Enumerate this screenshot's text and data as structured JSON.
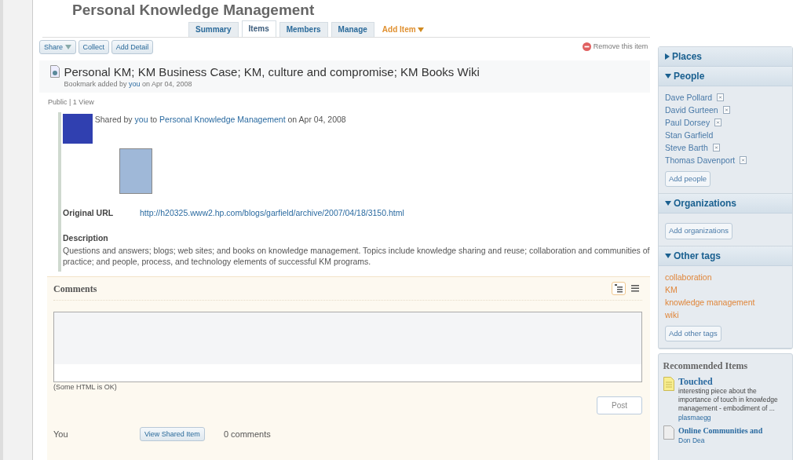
{
  "page_title": "Personal Knowledge Management",
  "tabs": [
    {
      "label": "Summary",
      "selected": false
    },
    {
      "label": "Items",
      "selected": true
    },
    {
      "label": "Members",
      "selected": false
    },
    {
      "label": "Manage",
      "selected": false
    }
  ],
  "add_item": {
    "label": "Add Item"
  },
  "toolbar": [
    {
      "label": "Share",
      "dropdown": true
    },
    {
      "label": "Collect",
      "dropdown": false
    },
    {
      "label": "Add Detail",
      "dropdown": false
    }
  ],
  "remove_link": "Remove this item",
  "item": {
    "title": "Personal KM; KM Business Case; KM, culture and compromise; KM Books Wiki",
    "added_prefix": "Bookmark added by",
    "added_by": "you",
    "added_date": "on Apr 04, 2008",
    "visibility": "Public | 1 View",
    "shared_prefix": "Shared by",
    "shared_by": "you",
    "shared_to_word": "to",
    "shared_group": "Personal Knowledge Management",
    "shared_date": "on Apr 04, 2008",
    "url_label": "Original URL",
    "url": "http://h20325.www2.hp.com/blogs/garfield/archive/2007/04/18/3150.html",
    "description_label": "Description",
    "description": "Questions and answers; blogs; web sites; and books on knowledge management. Topics include knowledge sharing and reuse; collaboration and communities of practice; and people, process, and technology elements of successful KM programs."
  },
  "comments": {
    "title": "Comments",
    "views": [
      {
        "kind": "threaded",
        "selected": true
      },
      {
        "kind": "flat",
        "selected": false
      }
    ],
    "html_note": "(Some HTML is OK)",
    "post": "Post",
    "footer": {
      "user": "You",
      "view_button": "View Shared Item",
      "count": "0 comments"
    }
  },
  "sidebar": {
    "sections": [
      {
        "title": "Places",
        "expanded": false
      },
      {
        "title": "People",
        "expanded": true,
        "items": [
          {
            "label": "Dave Pollard",
            "removable": true
          },
          {
            "label": "David Gurteen",
            "removable": true
          },
          {
            "label": "Paul Dorsey",
            "removable": true
          },
          {
            "label": "Stan Garfield",
            "removable": false
          },
          {
            "label": "Steve Barth",
            "removable": true
          },
          {
            "label": "Thomas Davenport",
            "removable": true
          }
        ],
        "button": "Add people"
      },
      {
        "title": "Organizations",
        "expanded": true,
        "button": "Add organizations"
      },
      {
        "title": "Other tags",
        "expanded": true,
        "tags": [
          "collaboration",
          "KM",
          "knowledge management",
          "wiki"
        ],
        "button": "Add other tags"
      }
    ],
    "recommended": {
      "title": "Recommended Items",
      "items": [
        {
          "title": "Touched",
          "summary": "interesting piece about the importance of touch in knowledge management - embodiment of ...",
          "author": "plasmaegg"
        },
        {
          "title": "Online Communities and",
          "author": "Don Dea"
        }
      ]
    }
  }
}
